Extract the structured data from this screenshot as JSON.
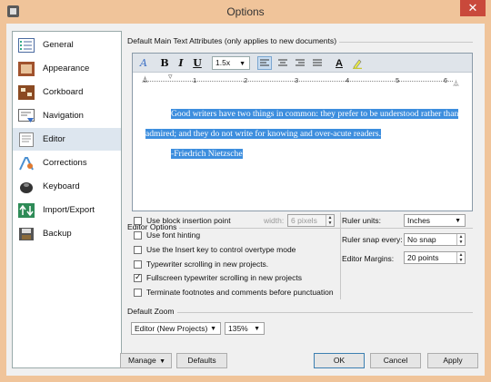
{
  "window": {
    "title": "Options"
  },
  "sidebar": {
    "items": [
      {
        "label": "General",
        "icon": "general-list-icon"
      },
      {
        "label": "Appearance",
        "icon": "appearance-icon"
      },
      {
        "label": "Corkboard",
        "icon": "corkboard-icon"
      },
      {
        "label": "Navigation",
        "icon": "navigation-icon"
      },
      {
        "label": "Editor",
        "icon": "editor-icon",
        "selected": true
      },
      {
        "label": "Corrections",
        "icon": "corrections-icon"
      },
      {
        "label": "Keyboard",
        "icon": "keyboard-icon"
      },
      {
        "label": "Import/Export",
        "icon": "import-export-icon"
      },
      {
        "label": "Backup",
        "icon": "backup-icon"
      }
    ]
  },
  "text_attributes": {
    "group_label": "Default Main Text Attributes (only applies to new documents)",
    "toolbar": {
      "bold": "B",
      "italic": "I",
      "underline": "U",
      "line_spacing": "1.5x",
      "text_color": "A"
    },
    "ruler_numbers": [
      "1",
      "2",
      "3",
      "4",
      "5",
      "6"
    ],
    "sample_lines": [
      "Good writers have two things in common: they prefer to be understood rather than",
      "admired; and they do not write for knowing and over-acute readers.",
      "-Friedrich Nietzsche"
    ]
  },
  "editor_options": {
    "group_label": "Editor Options",
    "checkboxes": [
      {
        "label": "Use block insertion point",
        "checked": false
      },
      {
        "label": "Use font hinting",
        "checked": false
      },
      {
        "label": "Use the Insert key to control overtype mode",
        "checked": false
      },
      {
        "label": "Typewriter scrolling in new projects.",
        "checked": false
      },
      {
        "label": "Fullscreen typewriter scrolling in new projects",
        "checked": true
      },
      {
        "label": "Terminate footnotes and comments before punctuation",
        "checked": false
      }
    ],
    "width_label": "width:",
    "width_value": "6 pixels",
    "ruler_units_label": "Ruler units:",
    "ruler_units_value": "Inches",
    "ruler_snap_label": "Ruler snap every:",
    "ruler_snap_value": "No snap",
    "margins_label": "Editor Margins:",
    "margins_value": "20 points"
  },
  "zoom": {
    "group_label": "Default Zoom",
    "target_value": "Editor (New Projects)",
    "zoom_value": "135%"
  },
  "footer": {
    "manage": "Manage",
    "defaults": "Defaults",
    "ok": "OK",
    "cancel": "Cancel",
    "apply": "Apply"
  },
  "colors": {
    "selection": "#3d8ede",
    "window_frame": "#f0c49a",
    "close": "#c9493b"
  }
}
